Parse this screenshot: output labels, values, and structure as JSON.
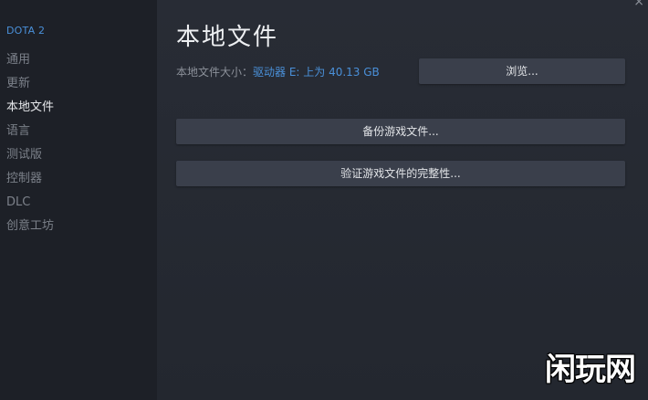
{
  "sidebar": {
    "game_title": "DOTA 2",
    "items": [
      {
        "label": "通用"
      },
      {
        "label": "更新"
      },
      {
        "label": "本地文件"
      },
      {
        "label": "语言"
      },
      {
        "label": "测试版"
      },
      {
        "label": "控制器"
      },
      {
        "label": "DLC"
      },
      {
        "label": "创意工坊"
      }
    ],
    "active_index": 2
  },
  "main": {
    "title": "本地文件",
    "size_label": "本地文件大小：",
    "size_value": "驱动器 E: 上为 40.13 GB",
    "browse_label": "浏览...",
    "backup_label": "备份游戏文件...",
    "verify_label": "验证游戏文件的完整性..."
  },
  "window": {
    "close_glyph": "×"
  },
  "watermark": {
    "text": "闲玩网"
  },
  "colors": {
    "accent": "#4a90d9",
    "background": "#23272f",
    "sidebar": "#1d2027",
    "button": "#3a3f4b"
  }
}
